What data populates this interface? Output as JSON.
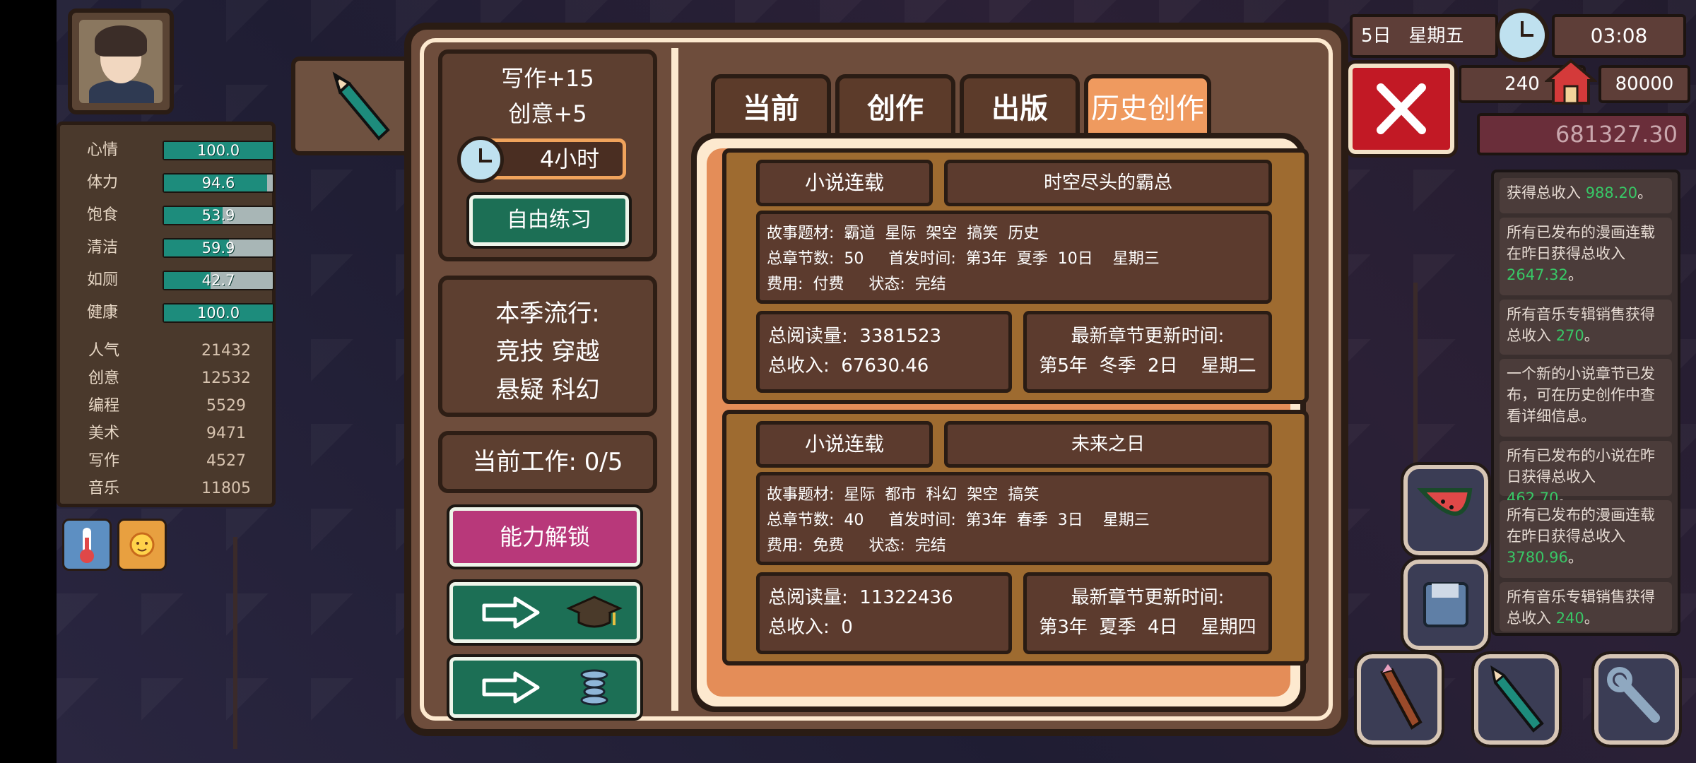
{
  "stats": [
    {
      "name": "心情",
      "value": "100.0",
      "fill": 1.0
    },
    {
      "name": "体力",
      "value": "94.6",
      "fill": 0.946
    },
    {
      "name": "饱食",
      "value": "53.9",
      "fill": 0.539
    },
    {
      "name": "清洁",
      "value": "59.9",
      "fill": 0.599
    },
    {
      "name": "如厕",
      "value": "42.7",
      "fill": 0.427
    },
    {
      "name": "健康",
      "value": "100.0",
      "fill": 1.0
    }
  ],
  "attributes": [
    {
      "name": "人气",
      "value": "21432"
    },
    {
      "name": "创意",
      "value": "12532"
    },
    {
      "name": "编程",
      "value": "5529"
    },
    {
      "name": "美术",
      "value": "9471"
    },
    {
      "name": "写作",
      "value": "4527"
    },
    {
      "name": "音乐",
      "value": "11805"
    }
  ],
  "left_panel": {
    "bonus_writing": "写作+15",
    "bonus_creativity": "创意+5",
    "duration": "4小时",
    "practice_button": "自由练习",
    "trend_title": "本季流行:",
    "trend_line1": "竞技 穿越",
    "trend_line2": "悬疑 科幻",
    "current_work": "当前工作: 0/5",
    "unlock_button": "能力解锁"
  },
  "tabs": [
    "当前",
    "创作",
    "出版",
    "历史创作"
  ],
  "active_tab": 3,
  "works": [
    {
      "type": "小说连载",
      "title": "时空尽头的霸总",
      "genre_line": "故事题材:  霸道  星际  架空  搞笑  历史",
      "chapters_line": "总章节数:  50     首发时间:  第3年  夏季  10日    星期三",
      "fee_line": "费用:  付费     状态:  完结",
      "reads": "总阅读量:  3381523",
      "income": "总收入:  67630.46",
      "update_label": "最新章节更新时间:",
      "update_time": "第5年  冬季  2日    星期二"
    },
    {
      "type": "小说连载",
      "title": "未来之日",
      "genre_line": "故事题材:  星际  都市  科幻  架空  搞笑",
      "chapters_line": "总章节数:  40     首发时间:  第3年  春季  3日    星期三",
      "fee_line": "费用:  免费     状态:  完结",
      "reads": "总阅读量:  11322436",
      "income": "总收入:  0",
      "update_label": "最新章节更新时间:",
      "update_time": "第3年  夏季  4日    星期四"
    }
  ],
  "hud": {
    "date": "5日   星期五",
    "time": "03:08",
    "value_a": "240",
    "value_b": "80000",
    "money": "681327.30"
  },
  "feed": [
    {
      "text": "获得总收入 ",
      "num": "988.20",
      "tail": "。"
    },
    {
      "text": "所有已发布的漫画连载在昨日获得总收入 ",
      "num": "2647.32",
      "tail": "。"
    },
    {
      "text": "所有音乐专辑销售获得总收入 ",
      "num": "270",
      "tail": "。"
    },
    {
      "text": "一个新的小说章节已发布，可在历史创作中查看详细信息。",
      "num": "",
      "tail": ""
    },
    {
      "text": "所有已发布的小说在昨日获得总收入 ",
      "num": "462.70",
      "tail": "。"
    },
    {
      "text": "所有已发布的漫画连载在昨日获得总收入 ",
      "num": "3780.96",
      "tail": "。"
    },
    {
      "text": "所有音乐专辑销售获得总收入 ",
      "num": "240",
      "tail": "。"
    }
  ],
  "icons": [
    "pencil-icon",
    "stopwatch-icon",
    "arrow-right-icon",
    "graduation-cap-icon",
    "coil-icon",
    "close-icon",
    "thermometer-icon",
    "sun-icon",
    "house-icon",
    "watermelon-icon",
    "brush-icon",
    "wrench-icon",
    "floppy-icon"
  ],
  "colors": {
    "accent_orange": "#ef9a5f",
    "panel_brown": "#6e4d3c",
    "button_green": "#1c6f55",
    "unlock_pink": "#b8387a",
    "close_red": "#c21925",
    "income_green": "#38c766"
  }
}
